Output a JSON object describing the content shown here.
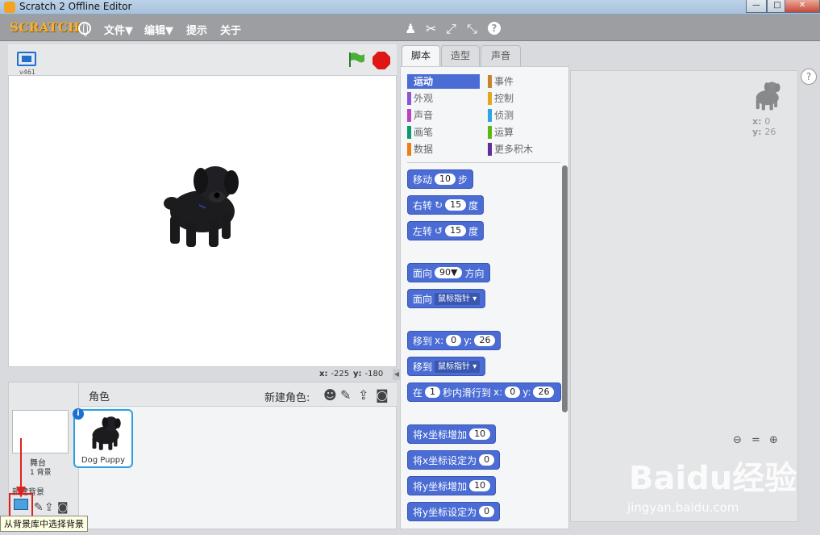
{
  "window": {
    "title": "Scratch 2 Offline Editor",
    "controls": [
      "—",
      "□",
      "✕"
    ]
  },
  "menubar": {
    "logo": "SCRATCH",
    "menus": [
      "文件▼",
      "编辑▼",
      "提示",
      "关于"
    ],
    "tools": [
      "duplicate-icon",
      "cut-icon",
      "grow-icon",
      "shrink-icon",
      "help-icon"
    ]
  },
  "stage": {
    "version": "v461",
    "mouse_x_label": "x:",
    "mouse_x": "-225",
    "mouse_y_label": "y:",
    "mouse_y": "-180"
  },
  "tabs": [
    "脚本",
    "造型",
    "声音"
  ],
  "categories": [
    {
      "label": "运动",
      "color": "#4a6cd4"
    },
    {
      "label": "事件",
      "color": "#c88330"
    },
    {
      "label": "外观",
      "color": "#8a55d7"
    },
    {
      "label": "控制",
      "color": "#e1a91a"
    },
    {
      "label": "声音",
      "color": "#bb42c3"
    },
    {
      "label": "侦测",
      "color": "#2ca5e2"
    },
    {
      "label": "画笔",
      "color": "#0e9a6c"
    },
    {
      "label": "运算",
      "color": "#5cb712"
    },
    {
      "label": "数据",
      "color": "#ee7d16"
    },
    {
      "label": "更多积木",
      "color": "#632d99"
    }
  ],
  "blocks": {
    "move": {
      "label": "移动",
      "value": "10",
      "suffix": "步"
    },
    "turn_right": {
      "label": "右转",
      "value": "15",
      "suffix": "度"
    },
    "turn_left": {
      "label": "左转",
      "value": "15",
      "suffix": "度"
    },
    "point_dir": {
      "label": "面向",
      "value": "90▼",
      "suffix": "方向"
    },
    "point_towards": {
      "label": "面向",
      "option": "鼠标指针"
    },
    "goto_xy": {
      "label": "移到",
      "x_label": "x:",
      "x": "0",
      "y_label": "y:",
      "y": "26"
    },
    "goto_target": {
      "label": "移到",
      "option": "鼠标指针"
    },
    "glide": {
      "label": "在",
      "secs": "1",
      "mid": "秒内滑行到",
      "x_label": "x:",
      "x": "0",
      "y_label": "y:",
      "y": "26"
    },
    "change_x": {
      "label": "将x坐标增加",
      "value": "10"
    },
    "set_x": {
      "label": "将x坐标设定为",
      "value": "0"
    },
    "change_y": {
      "label": "将y坐标增加",
      "value": "10"
    },
    "set_y": {
      "label": "将y坐标设定为",
      "value": "0"
    }
  },
  "sprites_pane": {
    "title": "角色",
    "new_sprite_label": "新建角色:",
    "stage_label": "舞台",
    "stage_bg_count": "1 背景",
    "new_backdrop_label": "新建背景",
    "sprite_name": "Dog Puppy",
    "tooltip": "从背景库中选择背景"
  },
  "script_area": {
    "x_label": "x:",
    "x": "0",
    "y_label": "y:",
    "y": "26"
  },
  "watermark": {
    "brand": "Baidu经验",
    "url": "jingyan.baidu.com"
  },
  "colors": {
    "motion": "#4a6cd4",
    "menubar": "#9c9ea2",
    "selection": "#2aa0e0",
    "highlight": "#e02020"
  }
}
